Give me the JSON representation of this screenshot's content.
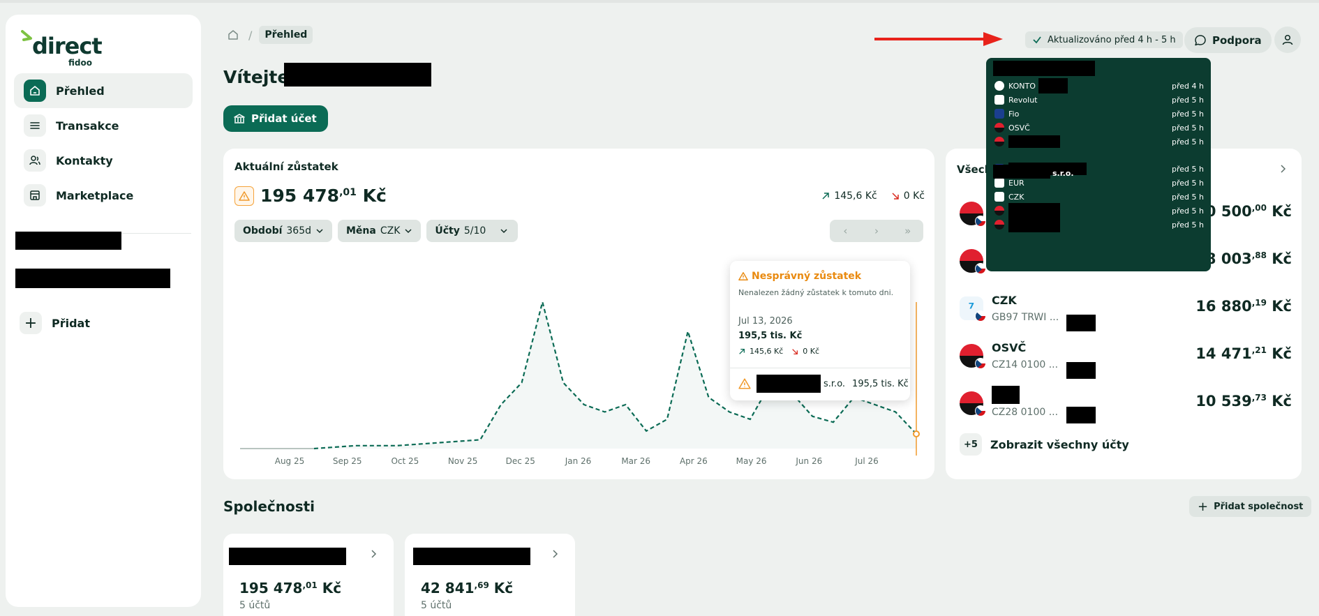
{
  "app": {
    "logo_text": "direct",
    "logo_sub": "fidoo"
  },
  "sidebar": {
    "items": [
      {
        "label": "Přehled",
        "icon": "home-icon",
        "active": true
      },
      {
        "label": "Transakce",
        "icon": "list-icon"
      },
      {
        "label": "Kontakty",
        "icon": "contacts-icon"
      },
      {
        "label": "Marketplace",
        "icon": "store-icon"
      }
    ],
    "add_label": "Přidat"
  },
  "breadcrumb": {
    "current": "Přehled"
  },
  "header": {
    "welcome": "Vítejte,",
    "add_account_label": "Přidat účet",
    "updated_label": "Aktualizováno před 4 h - 5 h",
    "support_label": "Podpora"
  },
  "balance": {
    "title": "Aktuální zůstatek",
    "amount_main": "195 478",
    "amount_dec": ",01",
    "amount_currency": " Kč",
    "inflow": "145,6 Kč",
    "outflow": "0 Kč",
    "filters": [
      {
        "label": "Období",
        "value": "365d"
      },
      {
        "label": "Měna",
        "value": "CZK"
      },
      {
        "label": "Účty",
        "value": "5/10"
      }
    ]
  },
  "chart_data": {
    "type": "line",
    "x_tick_labels": [
      "Aug 25",
      "Sep 25",
      "Oct 25",
      "Nov 25",
      "Dec 25",
      "Jan 26",
      "Mar 26",
      "Apr 26",
      "May 26",
      "Jun 26",
      "Jul 26"
    ],
    "series": [
      {
        "values": [
          0,
          1,
          2,
          2,
          2,
          3,
          4,
          5,
          6,
          30,
          45,
          100,
          45,
          30,
          25,
          30,
          12,
          20,
          80,
          35,
          25,
          20,
          45,
          38,
          22,
          18,
          35,
          30,
          25,
          10
        ]
      }
    ],
    "colors": {
      "line": "#0b6b55",
      "marker": "#f09a2c"
    }
  },
  "tooltip": {
    "title": "Nesprávný zůstatek",
    "desc": "Nenalezen žádný zůstatek k tomuto dni.",
    "date": "Jul 13, 2026",
    "value": "195,5 tis. Kč",
    "inflow": "145,6 Kč",
    "outflow": "0 Kč",
    "foot_suffix": "s.r.o.",
    "foot_value": "195,5 tis. Kč"
  },
  "accounts": {
    "head": "Všech",
    "rows": [
      {
        "name": "",
        "iban": "",
        "amount_main": "0 500",
        "amount_dec": ",00",
        "currency": " Kč",
        "logo": "kb"
      },
      {
        "name": "",
        "iban": "",
        "amount_main": "28 003",
        "amount_dec": ",88",
        "currency": " Kč",
        "logo": "kb"
      },
      {
        "name": "CZK",
        "iban": "GB97 TRWI ...",
        "amount_main": "16 880",
        "amount_dec": ",19",
        "currency": " Kč",
        "logo": "wise"
      },
      {
        "name": "OSVČ",
        "iban": "CZ14 0100 ...",
        "amount_main": "14 471",
        "amount_dec": ",21",
        "currency": " Kč",
        "logo": "kb"
      },
      {
        "name": "",
        "iban": "CZ28 0100 ...",
        "amount_main": "10 539",
        "amount_dec": ",73",
        "currency": " Kč",
        "logo": "kb"
      }
    ],
    "more_badge": "+5",
    "more_label": "Zobrazit všechny účty"
  },
  "popover": {
    "rows": [
      {
        "name": "KONTO",
        "time": "před 4 h",
        "icon": "ing"
      },
      {
        "name": "Revolut",
        "time": "před 5 h",
        "icon": "bank"
      },
      {
        "name": "Fio",
        "time": "před 5 h",
        "icon": "fio"
      },
      {
        "name": "OSVČ",
        "time": "před 5 h",
        "icon": "kb"
      },
      {
        "name": "",
        "time": "před 5 h",
        "icon": "kb"
      },
      {
        "name": "",
        "time": "před 5 h",
        "icon": "fio"
      },
      {
        "name": "EUR",
        "time": "před 5 h",
        "icon": "bank"
      },
      {
        "name": "CZK",
        "time": "před 5 h",
        "icon": "bank"
      },
      {
        "name": "",
        "time": "před 5 h",
        "icon": "kb"
      },
      {
        "name": "",
        "time": "před 5 h",
        "icon": "kb"
      }
    ],
    "group_suffix": "s.r.o."
  },
  "companies": {
    "title": "Společnosti",
    "add_label": "Přidat společnost",
    "cards": [
      {
        "amount_main": "195 478",
        "amount_dec": ",01",
        "currency": " Kč",
        "sub": "5 účtů"
      },
      {
        "amount_main": "42 841",
        "amount_dec": ",69",
        "currency": " Kč",
        "sub": "5 účtů"
      }
    ]
  }
}
